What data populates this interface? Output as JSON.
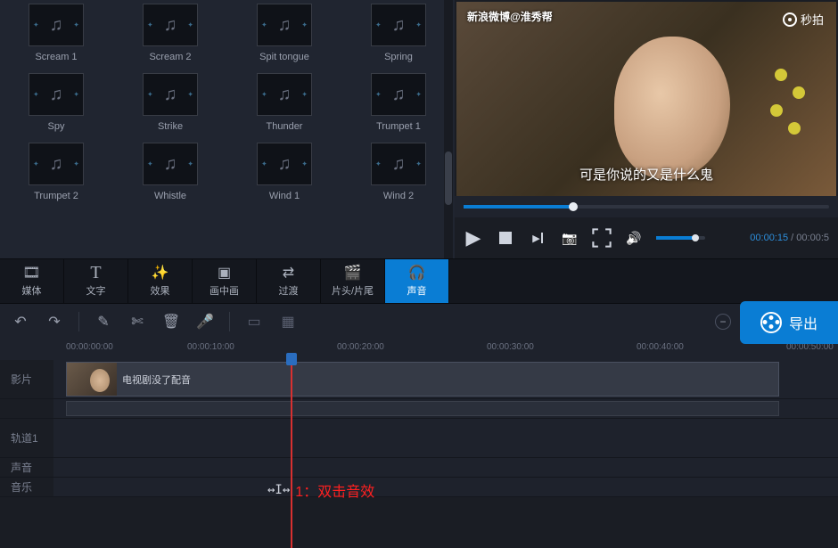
{
  "media_library": {
    "items": [
      {
        "label": "Scream 1"
      },
      {
        "label": "Scream 2"
      },
      {
        "label": "Spit tongue"
      },
      {
        "label": "Spring"
      },
      {
        "label": "Spy"
      },
      {
        "label": "Strike"
      },
      {
        "label": "Thunder"
      },
      {
        "label": "Trumpet 1"
      },
      {
        "label": "Trumpet 2"
      },
      {
        "label": "Whistle"
      },
      {
        "label": "Wind 1"
      },
      {
        "label": "Wind 2"
      }
    ]
  },
  "preview": {
    "watermark_left": "新浪微博@淮秀帮",
    "watermark_right": "秒拍",
    "subtitle": "可是你说的又是什么鬼",
    "time_current": "00:00:15",
    "time_total": "00:00:5"
  },
  "tabs": {
    "items": [
      {
        "label": "媒体",
        "icon": "film"
      },
      {
        "label": "文字",
        "icon": "text"
      },
      {
        "label": "效果",
        "icon": "wand"
      },
      {
        "label": "画中画",
        "icon": "pip"
      },
      {
        "label": "过渡",
        "icon": "transition"
      },
      {
        "label": "片头/片尾",
        "icon": "clapper"
      },
      {
        "label": "声音",
        "icon": "headphones",
        "active": true
      }
    ]
  },
  "export": {
    "label": "导出"
  },
  "timeline": {
    "ruler_marks": [
      "00:00:00:00",
      "00:00:10:00",
      "00:00:20:00",
      "00:00:30:00",
      "00:00:40:00",
      "00:00:50:00"
    ],
    "tracks": {
      "video": {
        "label": "影片",
        "clip_label": "电视剧没了配音"
      },
      "track1": {
        "label": "轨道1"
      },
      "sound": {
        "label": "声音"
      },
      "music": {
        "label": "音乐"
      }
    }
  },
  "annotation": {
    "text": "1：双击音效"
  }
}
